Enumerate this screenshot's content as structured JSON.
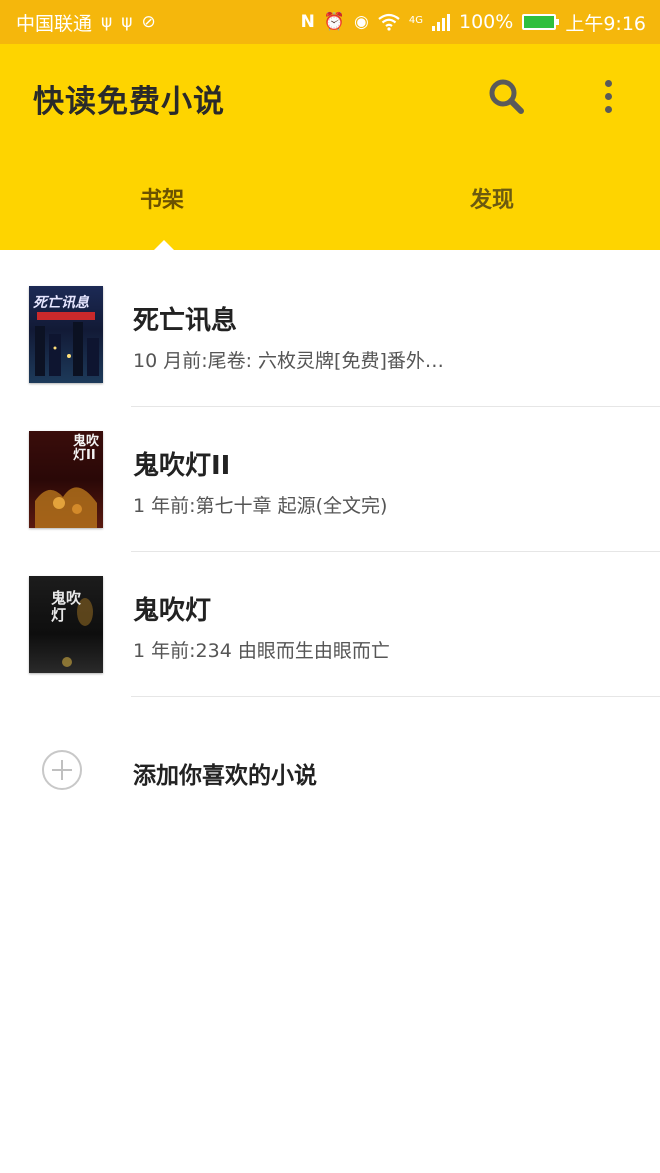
{
  "status_bar": {
    "carrier": "中国联通",
    "battery": "100%",
    "network": "4G",
    "time": "上午9:16",
    "icons_left": [
      "usb-icon",
      "usb-icon",
      "sync-icon"
    ],
    "icons_right": [
      "nfc-icon",
      "alarm-icon",
      "eye-icon",
      "wifi-icon",
      "signal-icon",
      "battery-icon"
    ]
  },
  "app_bar": {
    "title": "快读免费小说",
    "search_icon": "search-icon",
    "more_icon": "more-vert-icon"
  },
  "tabs": [
    {
      "label": "书架",
      "selected": true
    },
    {
      "label": "发现",
      "selected": false
    }
  ],
  "books": [
    {
      "title": "死亡讯息",
      "subtitle": "10 月前:尾卷: 六枚灵牌[免费]番外…",
      "cover_text": "死亡讯息"
    },
    {
      "title": "鬼吹灯II",
      "subtitle": "1 年前:第七十章 起源(全文完)",
      "cover_text": "鬼吹灯II"
    },
    {
      "title": "鬼吹灯",
      "subtitle": "1 年前:234 由眼而生由眼而亡",
      "cover_text": "鬼吹灯"
    }
  ],
  "add_row": {
    "label": "添加你喜欢的小说",
    "icon": "add-circle-icon"
  },
  "colors": {
    "status_bar": "#f5b70c",
    "app_bar": "#fed400",
    "background": "#ffffff"
  }
}
